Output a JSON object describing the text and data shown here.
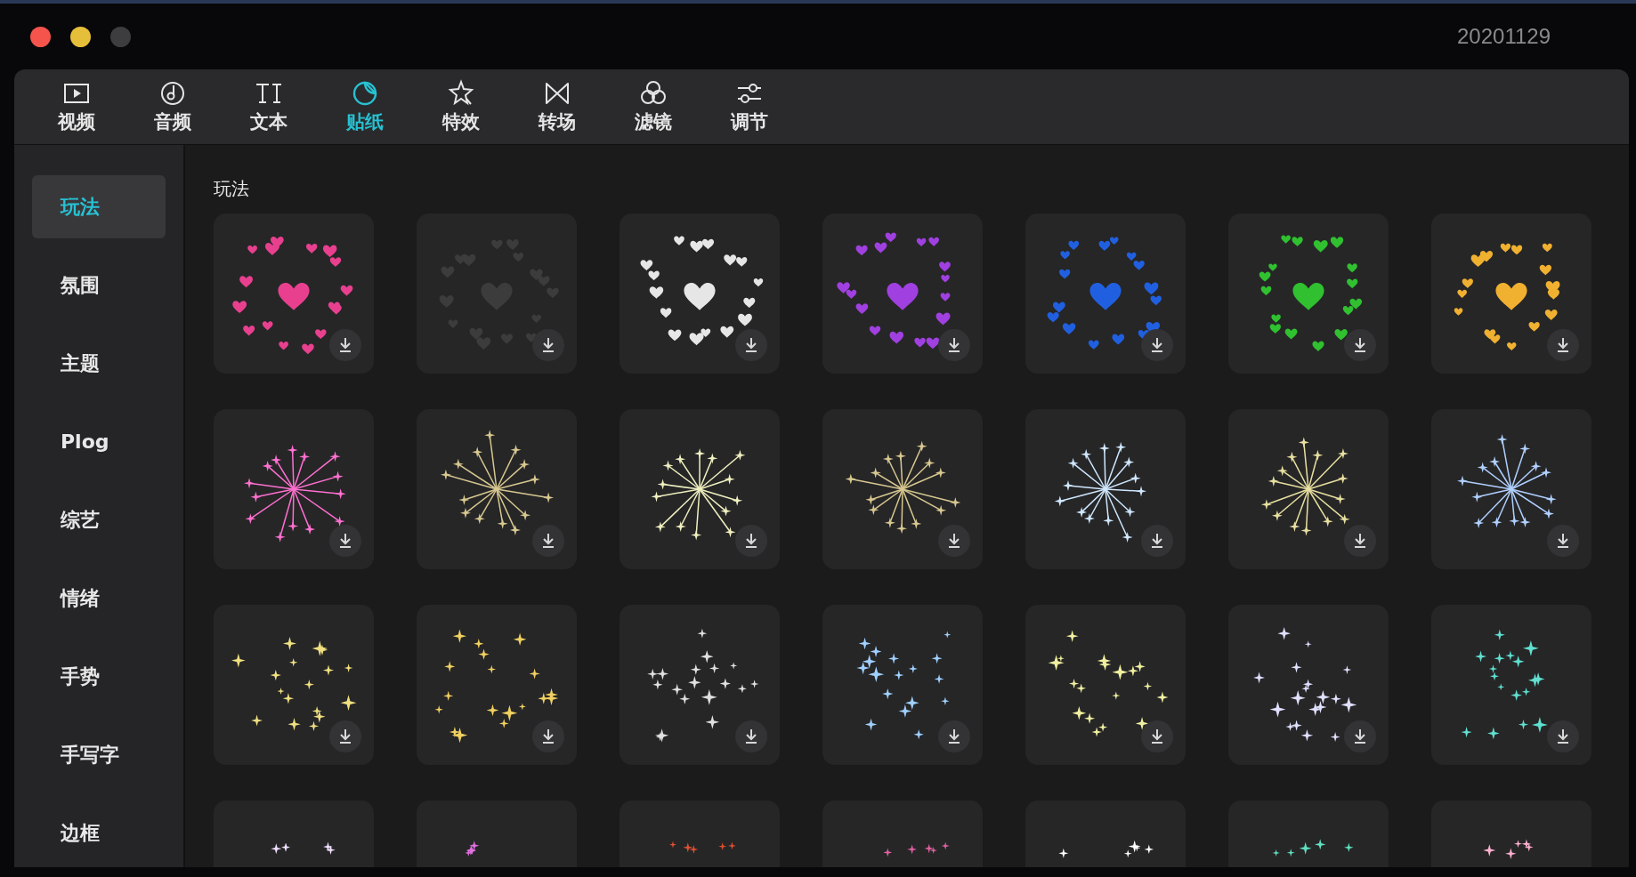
{
  "window": {
    "title": "20201129"
  },
  "toolbar": [
    {
      "kind": "video",
      "label": "视频",
      "selected": false
    },
    {
      "kind": "audio",
      "label": "音频",
      "selected": false
    },
    {
      "kind": "text",
      "label": "文本",
      "selected": false
    },
    {
      "kind": "sticker",
      "label": "贴纸",
      "selected": true
    },
    {
      "kind": "effect",
      "label": "特效",
      "selected": false
    },
    {
      "kind": "transition",
      "label": "转场",
      "selected": false
    },
    {
      "kind": "filter",
      "label": "滤镜",
      "selected": false
    },
    {
      "kind": "adjust",
      "label": "调节",
      "selected": false
    }
  ],
  "sidebar": {
    "items": [
      {
        "label": "玩法",
        "selected": true
      },
      {
        "label": "氛围",
        "selected": false
      },
      {
        "label": "主题",
        "selected": false
      },
      {
        "label": "Plog",
        "selected": false
      },
      {
        "label": "综艺",
        "selected": false
      },
      {
        "label": "情绪",
        "selected": false
      },
      {
        "label": "手势",
        "selected": false
      },
      {
        "label": "手写字",
        "selected": false
      },
      {
        "label": "边框",
        "selected": false
      }
    ]
  },
  "section": {
    "title": "玩法"
  },
  "stickers": [
    {
      "kind": "hearts",
      "color": "#e8408f"
    },
    {
      "kind": "hearts",
      "color": "#3c3c3c"
    },
    {
      "kind": "hearts",
      "color": "#e6e6e6"
    },
    {
      "kind": "hearts",
      "color": "#a040e0"
    },
    {
      "kind": "hearts",
      "color": "#2060e0"
    },
    {
      "kind": "hearts",
      "color": "#30c030"
    },
    {
      "kind": "hearts",
      "color": "#f0b030"
    },
    {
      "kind": "burst",
      "color": "#ff70d0"
    },
    {
      "kind": "burst",
      "color": "#d8c890"
    },
    {
      "kind": "burst",
      "color": "#f0f0c0"
    },
    {
      "kind": "burst",
      "color": "#d8c890"
    },
    {
      "kind": "burst",
      "color": "#d0e8ff"
    },
    {
      "kind": "burst",
      "color": "#e8e0a0"
    },
    {
      "kind": "burst",
      "color": "#b0d0ff"
    },
    {
      "kind": "sparkles",
      "color": "#f0e080"
    },
    {
      "kind": "sparkles",
      "color": "#f0d060"
    },
    {
      "kind": "sparkles",
      "color": "#e0e0e0"
    },
    {
      "kind": "sparkles",
      "color": "#a0d0ff"
    },
    {
      "kind": "sparkles",
      "color": "#f0f0a0"
    },
    {
      "kind": "sparkles",
      "color": "#e0e0ff"
    },
    {
      "kind": "sparkles",
      "color": "#60e0d0"
    },
    {
      "kind": "partial",
      "color": "#f0e0ff"
    },
    {
      "kind": "partial",
      "color": "#e070e0"
    },
    {
      "kind": "partial",
      "color": "#e05030"
    },
    {
      "kind": "partial",
      "color": "#e060a0"
    },
    {
      "kind": "partial",
      "color": "#ffffff"
    },
    {
      "kind": "partial",
      "color": "#60e0c0"
    },
    {
      "kind": "partial",
      "color": "#ffb0d0"
    }
  ]
}
